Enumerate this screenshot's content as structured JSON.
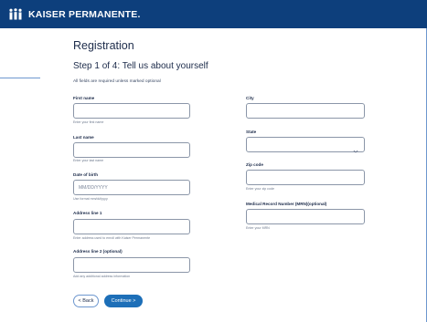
{
  "header": {
    "logo_text": "KAISER PERMANENTE.",
    "brand_color": "#0d3f7c"
  },
  "page": {
    "title": "Registration",
    "step": "Step 1 of 4: Tell us about yourself",
    "note": "All fields are required unless marked optional"
  },
  "fields": {
    "first_name": {
      "label": "First name",
      "value": "",
      "help": "Enter your first name"
    },
    "last_name": {
      "label": "Last name",
      "value": "",
      "help": "Enter your last name"
    },
    "dob": {
      "label": "Date of birth",
      "placeholder": "MM/DD/YYYY",
      "help": "Use format mm/dd/yyyy"
    },
    "address1": {
      "label": "Address line 1",
      "value": "",
      "help": "Enter address used to enroll with Kaiser Permanente"
    },
    "address2": {
      "label": "Address line 2 (optional)",
      "value": "",
      "help": "Add any additional address information"
    },
    "city": {
      "label": "City",
      "value": ""
    },
    "state": {
      "label": "State",
      "selected": ""
    },
    "zip": {
      "label": "Zip code",
      "value": "",
      "help": "Enter your zip code"
    },
    "mrn": {
      "label": "Medical Record Number (MRN)(optional)",
      "value": "",
      "help": "Enter your MRN"
    }
  },
  "buttons": {
    "back": "< Back",
    "continue": "Continue >"
  },
  "colors": {
    "primary_button": "#1d6fb8",
    "accent": "#6d97cf"
  },
  "icons": {
    "logo": "kaiser-people-icon",
    "dropdown": "chevron-down-icon"
  }
}
